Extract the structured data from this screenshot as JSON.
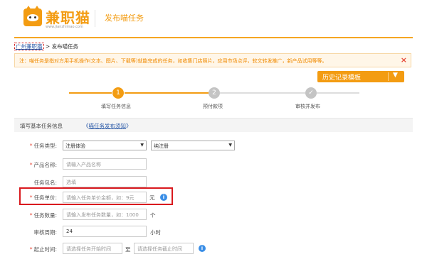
{
  "header": {
    "logo_text": "兼职猫",
    "logo_url": "www.jianzhimao.com",
    "title": "发布喵任务"
  },
  "breadcrumb": {
    "city": "广州兼职猫",
    "separator": " > ",
    "current": "发布喵任务"
  },
  "notice": {
    "text": "注：喵任务是指对方用手机操作(文本、图片、下载等)就能完成的任务，如收集门店照片，应用市场点评，软文转发推广，新产品试用等等。",
    "close": "×"
  },
  "history_button": {
    "label": "历史记录模板",
    "caret": "▼"
  },
  "steps": [
    {
      "number": "1",
      "label": "填写任务信息",
      "state": "active"
    },
    {
      "number": "2",
      "label": "预付款项",
      "state": "pending"
    },
    {
      "number": "✓",
      "label": "审核并发布",
      "state": "pending"
    }
  ],
  "section": {
    "title": "填写基本任务信息",
    "link_prefix": "《",
    "link": "喵任务发布须知",
    "link_suffix": "》"
  },
  "form": {
    "task_type": {
      "label": "任务类型:",
      "select1": "注册体验",
      "select2": "纯注册"
    },
    "product_name": {
      "label": "产品名称:",
      "placeholder": "请输入产品名称"
    },
    "task_package": {
      "label": "任务包名:",
      "value": "选填"
    },
    "unit_price": {
      "label": "任务单价:",
      "placeholder": "请输入任务单价金额，如：9元",
      "unit": "元"
    },
    "quantity": {
      "label": "任务数量:",
      "placeholder": "请输入发布任务数量，如：1000",
      "unit": "个"
    },
    "review_period": {
      "label": "审核周期:",
      "value": "24",
      "unit": "小时"
    },
    "time": {
      "label": "起止时间:",
      "start_placeholder": "请选择任务开始时间",
      "to": "至",
      "end_placeholder": "请选择任务截止时间"
    }
  },
  "colors": {
    "accent": "#f39c12",
    "link": "#2b5aa8",
    "required": "#e74c3c",
    "highlight": "#d9191e",
    "info": "#3a8ee6"
  },
  "icons": [
    "cat-logo-icon",
    "close-icon",
    "caret-down-icon",
    "check-icon",
    "info-icon"
  ]
}
